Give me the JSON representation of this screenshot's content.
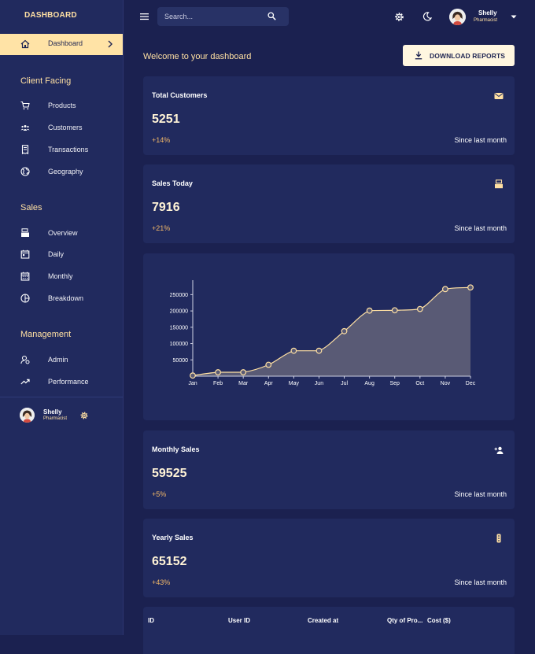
{
  "app": {
    "brand": "DASHBOARD"
  },
  "sidebar": {
    "active": {
      "label": "Dashboard",
      "icon": "home-icon"
    },
    "sections": [
      {
        "title": "Client Facing",
        "items": [
          {
            "label": "Products",
            "icon": "cart-icon"
          },
          {
            "label": "Customers",
            "icon": "people-icon"
          },
          {
            "label": "Transactions",
            "icon": "receipt-icon"
          },
          {
            "label": "Geography",
            "icon": "globe-icon"
          }
        ]
      },
      {
        "title": "Sales",
        "items": [
          {
            "label": "Overview",
            "icon": "point-of-sale-icon"
          },
          {
            "label": "Daily",
            "icon": "calendar-day-icon"
          },
          {
            "label": "Monthly",
            "icon": "calendar-month-icon"
          },
          {
            "label": "Breakdown",
            "icon": "pie-chart-icon"
          }
        ]
      },
      {
        "title": "Management",
        "items": [
          {
            "label": "Admin",
            "icon": "admin-icon"
          },
          {
            "label": "Performance",
            "icon": "trending-up-icon"
          }
        ]
      }
    ],
    "user": {
      "name": "Shelly",
      "role": "Pharmacist"
    }
  },
  "topbar": {
    "search_placeholder": "Search...",
    "user": {
      "name": "Shelly",
      "role": "Pharmacist"
    }
  },
  "main": {
    "welcome": "Welcome to your dashboard",
    "download_label": "DOWNLOAD REPORTS",
    "stats": [
      {
        "title": "Total Customers",
        "value": "5251",
        "delta": "+14%",
        "since": "Since last month",
        "icon": "email-icon"
      },
      {
        "title": "Sales Today",
        "value": "7916",
        "delta": "+21%",
        "since": "Since last month",
        "icon": "point-of-sale-icon"
      },
      {
        "title": "Monthly Sales",
        "value": "59525",
        "delta": "+5%",
        "since": "Since last month",
        "icon": "person-add-icon"
      },
      {
        "title": "Yearly Sales",
        "value": "65152",
        "delta": "+43%",
        "since": "Since last month",
        "icon": "traffic-icon"
      }
    ],
    "table_headers": [
      "ID",
      "User ID",
      "Created at",
      "Qty of Pro...",
      "Cost ($)"
    ]
  },
  "colors": {
    "background": "#1b2150",
    "panel": "#212a5e",
    "accent": "#ffe0a3",
    "area_fill": "#595a75",
    "delta": "#f2b868"
  },
  "chart_data": {
    "type": "area",
    "categories": [
      "Jan",
      "Feb",
      "Mar",
      "Apr",
      "May",
      "Jun",
      "Jul",
      "Aug",
      "Sep",
      "Oct",
      "Nov",
      "Dec"
    ],
    "values": [
      2000,
      12000,
      12000,
      35000,
      78000,
      78000,
      138000,
      201000,
      202000,
      206000,
      267000,
      272000
    ],
    "yticks": [
      50000,
      100000,
      150000,
      200000,
      250000
    ],
    "ylim": [
      0,
      275000
    ],
    "title": "",
    "xlabel": "",
    "ylabel": ""
  }
}
